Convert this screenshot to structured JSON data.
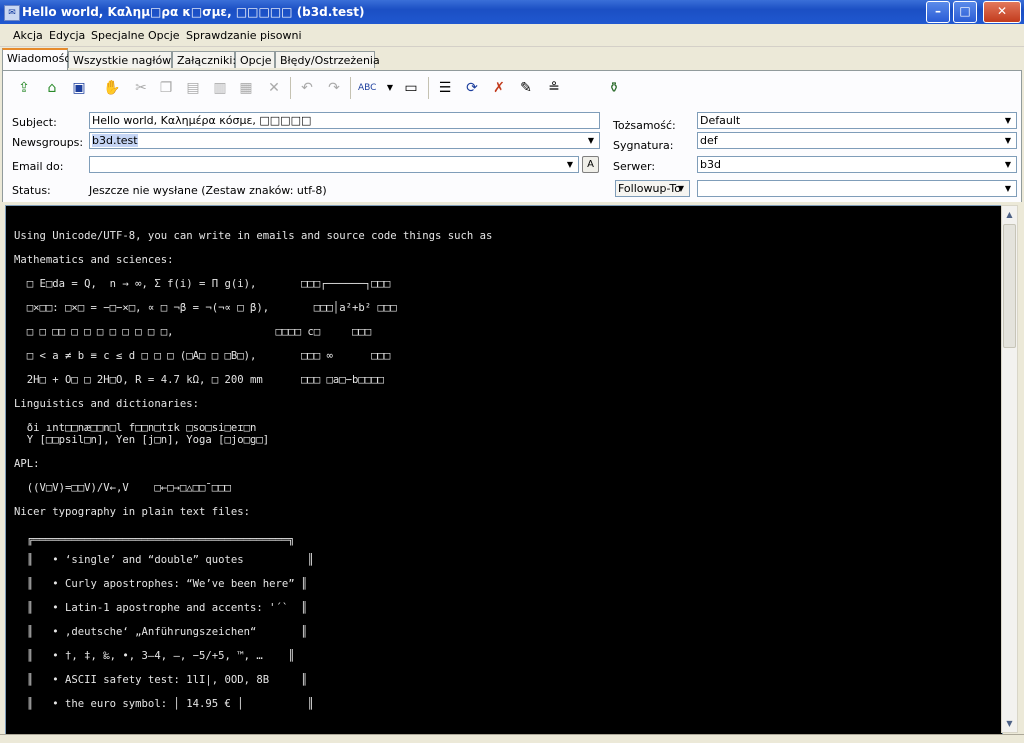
{
  "window": {
    "title": "Hello world, Καλημ□ρα κ□σμε, □□□□□ (b3d.test)",
    "minimize": "–",
    "maximize": "□",
    "close": "✕"
  },
  "menu": [
    "Akcja",
    "Edycja",
    "Specjalne",
    "Opcje",
    "Sprawdzanie pisowni"
  ],
  "tabs": [
    "Wiadomość",
    "Wszystkie nagłówki",
    "Załączniki:",
    "Opcje",
    "Błędy/Ostrzeżenia"
  ],
  "toolbar_icons": [
    "send-icon",
    "send-later-icon",
    "save-icon",
    "hand-icon",
    "cut-icon",
    "copy-icon",
    "paste-icon",
    "paste-quote-icon",
    "paste-special-icon",
    "delete-icon",
    "undo-icon",
    "redo-icon",
    "spellcheck-icon",
    "dropdown-arrow-icon",
    "text-icon",
    "wrap-icon",
    "rot13-icon",
    "unwrap-icon",
    "notes-icon",
    "signature-icon",
    "attach-icon"
  ],
  "headers": {
    "subject_label": "Subject:",
    "subject_value": "Hello world, Καλημέρα κόσμε, □□□□□",
    "newsgroups_label": "Newsgroups:",
    "newsgroups_value": "b3d.test",
    "email_label": "Email do:",
    "email_value": "",
    "email_btn": "A",
    "status_label": "Status:",
    "status_value": "Jeszcze nie wysłane (Zestaw znaków: utf-8)",
    "identity_label": "Tożsamość:",
    "identity_value": "Default",
    "signature_label": "Sygnatura:",
    "signature_value": "def",
    "server_label": "Serwer:",
    "server_value": "b3d",
    "followup_label": "Followup-To",
    "followup_value": ""
  },
  "body": [
    "Using Unicode/UTF-8, you can write in emails and source code things such as",
    "Mathematics and sciences:",
    "  □ E□da = Q,  n → ∞, Σ f(i) = Π g(i),       □□□┌──────┐□□□",
    "  □×□□: □×□ = −□−×□, ∝ □ ¬β = ¬(¬∝ □ β),       □□□│a²+b² □□□",
    "  □ □ □□ □ □ □ □ □ □ □ □,                □□□□ c□     □□□",
    "  □ < a ≠ b ≡ c ≤ d □ □ □ (□A□ □ □B□),       □□□ ∞      □□□",
    "  2H□ + O□ □ 2H□O, R = 4.7 kΩ, □ 200 mm      □□□ □a□−b□□□□",
    "Linguistics and dictionaries:",
    "  ði ınt□□næ□□n□l f□□n□tɪk □so□si□eɪ□n",
    "  Y [□□psil□n], Yen [j□n], Yoga [□jo□g□]",
    "APL:",
    "  ((V□V)=□□V)/V←,V    □←□→□△□□¯□□□",
    "Nicer typography in plain text files:",
    "  ╔════════════════════════════════════════╗",
    "  ║   • ‘single’ and “double” quotes          ║",
    "  ║   • Curly apostrophes: “We’ve been here” ║",
    "  ║   • Latin-1 apostrophe and accents: '´`  ║",
    "  ║   • ‚deutsche‘ „Anführungszeichen“       ║",
    "  ║   • †, ‡, ‰, •, 3–4, —, −5/+5, ™, …    ║",
    "  ║   • ASCII safety test: 1lI|, 0OD, 8B     ║",
    "  ║   • the euro symbol: │ 14.95 € │          ║"
  ]
}
